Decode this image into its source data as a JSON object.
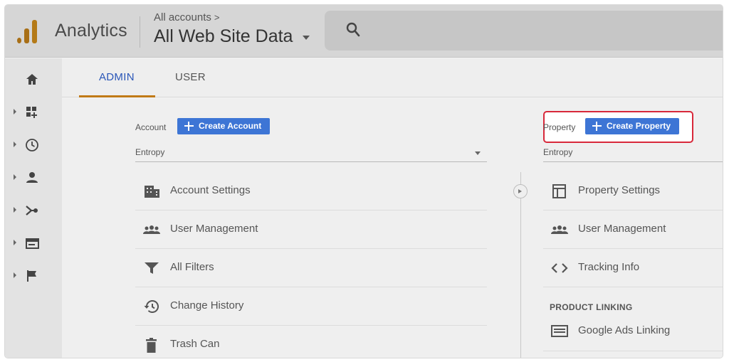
{
  "header": {
    "app_name": "Analytics",
    "breadcrumb": "All accounts",
    "breadcrumb_chevron": ">",
    "view_title": "All Web Site Data",
    "search_icon": "search-icon"
  },
  "rail": {
    "items": [
      {
        "icon": "home-icon"
      },
      {
        "icon": "dashboard-icon"
      },
      {
        "icon": "clock-icon"
      },
      {
        "icon": "person-icon"
      },
      {
        "icon": "acquisition-icon"
      },
      {
        "icon": "behavior-icon"
      },
      {
        "icon": "flag-icon"
      }
    ]
  },
  "tabs": {
    "admin": "ADMIN",
    "user": "USER",
    "active": "ADMIN"
  },
  "account": {
    "label": "Account",
    "create_button": "Create Account",
    "selected": "Entropy",
    "menu": [
      {
        "label": "Account Settings",
        "icon": "building-icon"
      },
      {
        "label": "User Management",
        "icon": "users-icon"
      },
      {
        "label": "All Filters",
        "icon": "filter-icon"
      },
      {
        "label": "Change History",
        "icon": "history-icon"
      },
      {
        "label": "Trash Can",
        "icon": "trash-icon"
      }
    ]
  },
  "property": {
    "label": "Property",
    "create_button": "Create Property",
    "selected": "Entropy",
    "menu": [
      {
        "label": "Property Settings",
        "icon": "settings-panel-icon"
      },
      {
        "label": "User Management",
        "icon": "users-icon"
      },
      {
        "label": "Tracking Info",
        "icon": "code-icon"
      }
    ],
    "section_heading": "PRODUCT LINKING",
    "linking": [
      {
        "label": "Google Ads Linking",
        "icon": "ads-icon"
      }
    ]
  },
  "colors": {
    "accent_blue": "#3d75d5",
    "highlight_red": "#d8283a",
    "logo_orange": "#b47a18"
  }
}
